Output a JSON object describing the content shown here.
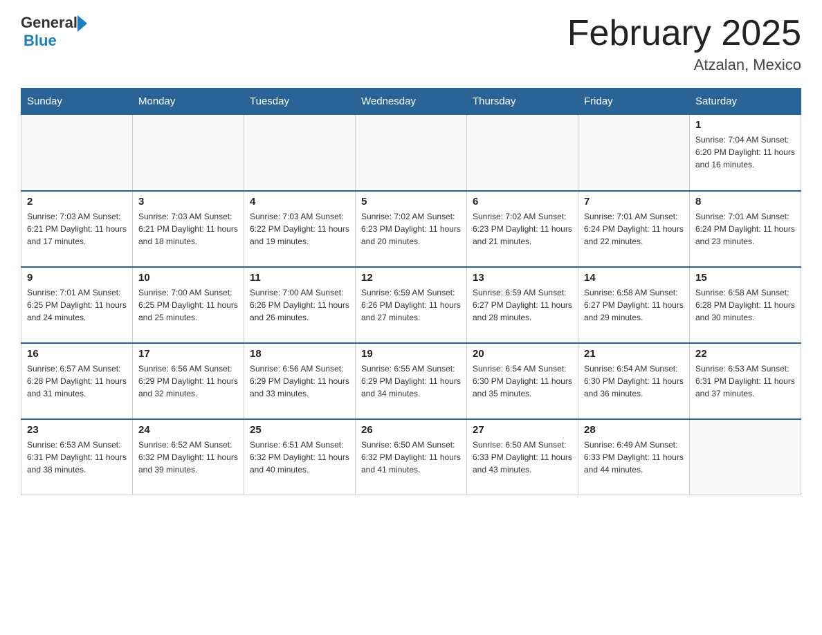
{
  "header": {
    "logo_general": "General",
    "logo_blue": "Blue",
    "month_title": "February 2025",
    "location": "Atzalan, Mexico"
  },
  "days_of_week": [
    "Sunday",
    "Monday",
    "Tuesday",
    "Wednesday",
    "Thursday",
    "Friday",
    "Saturday"
  ],
  "weeks": [
    [
      {
        "day": "",
        "info": ""
      },
      {
        "day": "",
        "info": ""
      },
      {
        "day": "",
        "info": ""
      },
      {
        "day": "",
        "info": ""
      },
      {
        "day": "",
        "info": ""
      },
      {
        "day": "",
        "info": ""
      },
      {
        "day": "1",
        "info": "Sunrise: 7:04 AM\nSunset: 6:20 PM\nDaylight: 11 hours and 16 minutes."
      }
    ],
    [
      {
        "day": "2",
        "info": "Sunrise: 7:03 AM\nSunset: 6:21 PM\nDaylight: 11 hours and 17 minutes."
      },
      {
        "day": "3",
        "info": "Sunrise: 7:03 AM\nSunset: 6:21 PM\nDaylight: 11 hours and 18 minutes."
      },
      {
        "day": "4",
        "info": "Sunrise: 7:03 AM\nSunset: 6:22 PM\nDaylight: 11 hours and 19 minutes."
      },
      {
        "day": "5",
        "info": "Sunrise: 7:02 AM\nSunset: 6:23 PM\nDaylight: 11 hours and 20 minutes."
      },
      {
        "day": "6",
        "info": "Sunrise: 7:02 AM\nSunset: 6:23 PM\nDaylight: 11 hours and 21 minutes."
      },
      {
        "day": "7",
        "info": "Sunrise: 7:01 AM\nSunset: 6:24 PM\nDaylight: 11 hours and 22 minutes."
      },
      {
        "day": "8",
        "info": "Sunrise: 7:01 AM\nSunset: 6:24 PM\nDaylight: 11 hours and 23 minutes."
      }
    ],
    [
      {
        "day": "9",
        "info": "Sunrise: 7:01 AM\nSunset: 6:25 PM\nDaylight: 11 hours and 24 minutes."
      },
      {
        "day": "10",
        "info": "Sunrise: 7:00 AM\nSunset: 6:25 PM\nDaylight: 11 hours and 25 minutes."
      },
      {
        "day": "11",
        "info": "Sunrise: 7:00 AM\nSunset: 6:26 PM\nDaylight: 11 hours and 26 minutes."
      },
      {
        "day": "12",
        "info": "Sunrise: 6:59 AM\nSunset: 6:26 PM\nDaylight: 11 hours and 27 minutes."
      },
      {
        "day": "13",
        "info": "Sunrise: 6:59 AM\nSunset: 6:27 PM\nDaylight: 11 hours and 28 minutes."
      },
      {
        "day": "14",
        "info": "Sunrise: 6:58 AM\nSunset: 6:27 PM\nDaylight: 11 hours and 29 minutes."
      },
      {
        "day": "15",
        "info": "Sunrise: 6:58 AM\nSunset: 6:28 PM\nDaylight: 11 hours and 30 minutes."
      }
    ],
    [
      {
        "day": "16",
        "info": "Sunrise: 6:57 AM\nSunset: 6:28 PM\nDaylight: 11 hours and 31 minutes."
      },
      {
        "day": "17",
        "info": "Sunrise: 6:56 AM\nSunset: 6:29 PM\nDaylight: 11 hours and 32 minutes."
      },
      {
        "day": "18",
        "info": "Sunrise: 6:56 AM\nSunset: 6:29 PM\nDaylight: 11 hours and 33 minutes."
      },
      {
        "day": "19",
        "info": "Sunrise: 6:55 AM\nSunset: 6:29 PM\nDaylight: 11 hours and 34 minutes."
      },
      {
        "day": "20",
        "info": "Sunrise: 6:54 AM\nSunset: 6:30 PM\nDaylight: 11 hours and 35 minutes."
      },
      {
        "day": "21",
        "info": "Sunrise: 6:54 AM\nSunset: 6:30 PM\nDaylight: 11 hours and 36 minutes."
      },
      {
        "day": "22",
        "info": "Sunrise: 6:53 AM\nSunset: 6:31 PM\nDaylight: 11 hours and 37 minutes."
      }
    ],
    [
      {
        "day": "23",
        "info": "Sunrise: 6:53 AM\nSunset: 6:31 PM\nDaylight: 11 hours and 38 minutes."
      },
      {
        "day": "24",
        "info": "Sunrise: 6:52 AM\nSunset: 6:32 PM\nDaylight: 11 hours and 39 minutes."
      },
      {
        "day": "25",
        "info": "Sunrise: 6:51 AM\nSunset: 6:32 PM\nDaylight: 11 hours and 40 minutes."
      },
      {
        "day": "26",
        "info": "Sunrise: 6:50 AM\nSunset: 6:32 PM\nDaylight: 11 hours and 41 minutes."
      },
      {
        "day": "27",
        "info": "Sunrise: 6:50 AM\nSunset: 6:33 PM\nDaylight: 11 hours and 43 minutes."
      },
      {
        "day": "28",
        "info": "Sunrise: 6:49 AM\nSunset: 6:33 PM\nDaylight: 11 hours and 44 minutes."
      },
      {
        "day": "",
        "info": ""
      }
    ]
  ]
}
